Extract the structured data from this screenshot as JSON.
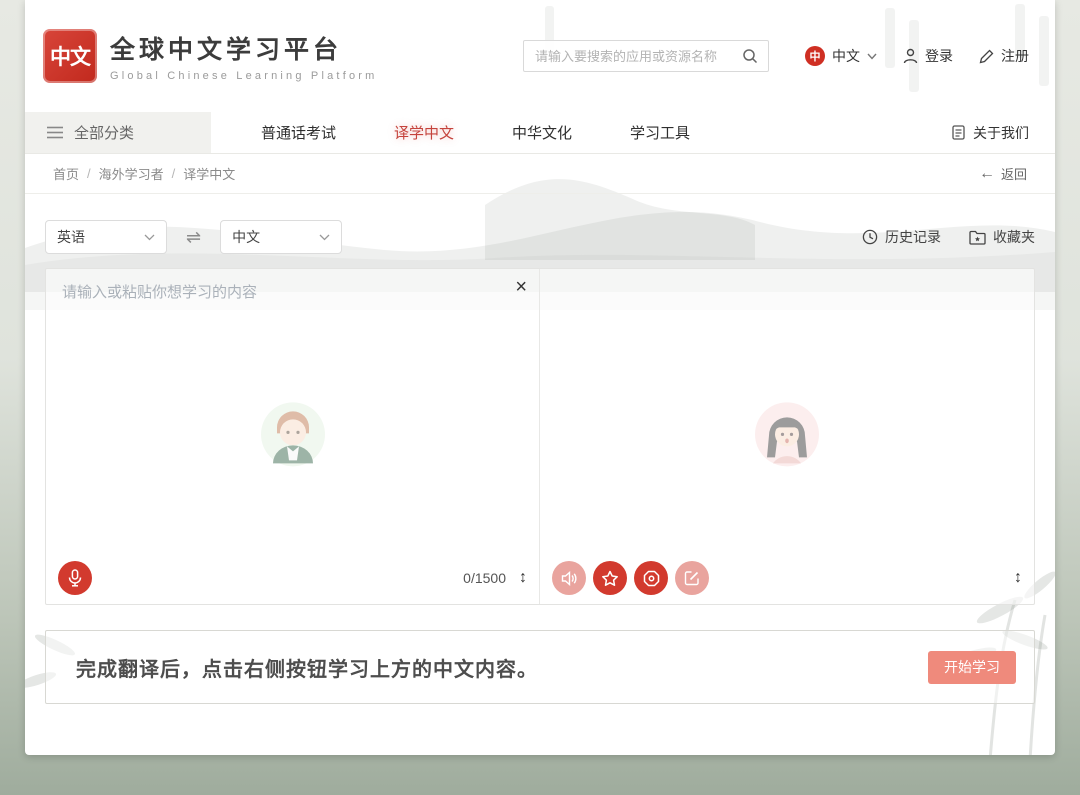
{
  "header": {
    "logo_seal_text": "中文",
    "logo_title": "全球中文学习平台",
    "logo_subtitle": "Global Chinese Learning Platform",
    "search_placeholder": "请输入要搜索的应用或资源名称",
    "language_badge": "中",
    "language_label": "中文",
    "login_label": "登录",
    "register_label": "注册"
  },
  "nav": {
    "all_categories_label": "全部分类",
    "items": [
      {
        "label": "普通话考试",
        "active": false
      },
      {
        "label": "译学中文",
        "active": true
      },
      {
        "label": "中华文化",
        "active": false
      },
      {
        "label": "学习工具",
        "active": false
      }
    ],
    "about_label": "关于我们"
  },
  "breadcrumb": {
    "items": [
      "首页",
      "海外学习者",
      "译学中文"
    ],
    "separator": "/",
    "back_label": "返回"
  },
  "toolbar": {
    "source_language": "英语",
    "target_language": "中文",
    "history_label": "历史记录",
    "favorites_label": "收藏夹"
  },
  "translator": {
    "input_placeholder": "请输入或粘贴你想学习的内容",
    "char_counter": "0/1500"
  },
  "instruction_bar": {
    "text": "完成翻译后，点击右侧按钮学习上方的中文内容。",
    "start_button_label": "开始学习"
  },
  "glyphs": {
    "swap": "⇌",
    "expand": "↕",
    "back_arrow": "←",
    "close": "×"
  },
  "colors": {
    "accent_red": "#d23a2e",
    "seal_red": "#c1291d",
    "start_button_pink": "#ef8a7c",
    "muted_button_pink": "#e9a49e",
    "active_nav_red": "#c5433c",
    "frame_sage_green": "#9fac9d"
  }
}
